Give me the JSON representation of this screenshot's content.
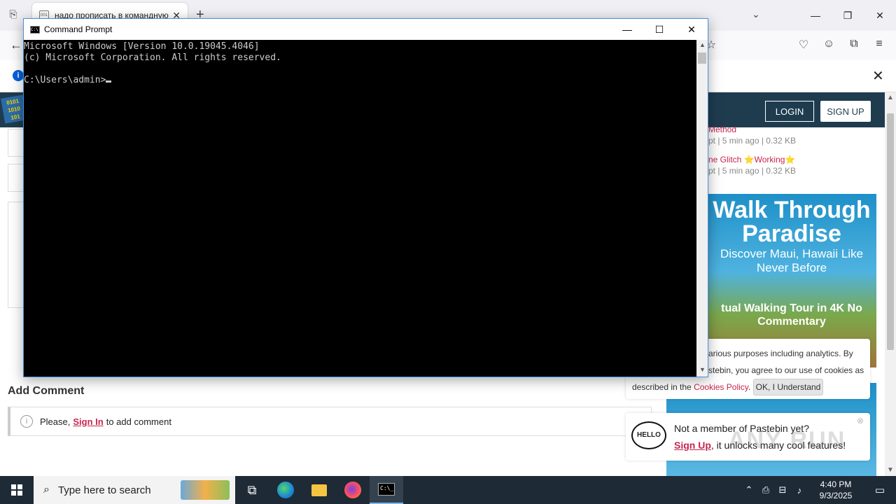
{
  "browser": {
    "tab_title": "надо прописать в командную",
    "tab_close": "✕",
    "new_tab": "+",
    "tab_list_icon": "⎘",
    "all_tabs_icon": "⌄",
    "window_controls": [
      "—",
      "❐",
      "✕"
    ],
    "back": "←",
    "toolbar_icons": [
      "☆",
      "♡",
      "☺",
      "⧉",
      "≡"
    ],
    "notification_close": "✕"
  },
  "page": {
    "login_label": "LOGIN",
    "signup_label": "SIGN UP",
    "recent": [
      {
        "name": "Method",
        "meta": "pt | 5 min ago | 0.32 KB"
      },
      {
        "name": "ne Glitch ⭐Working⭐",
        "meta": "pt | 5 min ago | 0.32 KB"
      }
    ],
    "ad": {
      "headline": "Walk Through Paradise",
      "sub": "Discover Maui, Hawaii Like Never Before",
      "tagline": "tual Walking Tour in 4K No Commentary"
    },
    "add_comment_title": "Add Comment",
    "comment_prefix": "Please,",
    "comment_link": "Sign In",
    "comment_suffix": "to add comment",
    "cookie": {
      "line1": "arious purposes including analytics. By",
      "line2": "stebin, you agree to our use of cookies as",
      "line3_prefix": "described in the",
      "policy_link": "Cookies Policy",
      "ok_label": "OK, I Understand"
    },
    "member": {
      "hello": "HELLO",
      "line1": "Not a member of Pastebin yet?",
      "signup_link": "Sign Up",
      "line2_suffix": ", it unlocks many cool features!",
      "close": "⊗"
    },
    "watermark": "ANY RUN"
  },
  "cmd": {
    "title": "Command Prompt",
    "controls": [
      "—",
      "☐",
      "✕"
    ],
    "lines": [
      "Microsoft Windows [Version 10.0.19045.4046]",
      "(c) Microsoft Corporation. All rights reserved.",
      "",
      "C:\\Users\\admin>"
    ]
  },
  "taskbar": {
    "search_placeholder": "Type here to search",
    "time": "4:40 PM",
    "date": "9/3/2025"
  }
}
